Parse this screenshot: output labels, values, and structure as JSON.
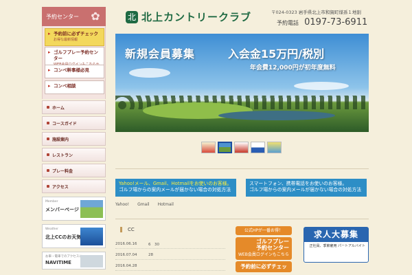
{
  "sidebar": {
    "header": "予約センター",
    "boxes": [
      {
        "title": "予約前に必ずチェック",
        "sub": "お得な最新情報"
      },
      {
        "title": "ゴルフプレー予約センター",
        "sub": "WEB会員ログインもこちらから"
      },
      {
        "title": "コンペ幹事様必見",
        "sub": ""
      },
      {
        "title": "コンペ相談",
        "sub": ""
      }
    ],
    "menu": [
      "ホーム",
      "コースガイド",
      "施設案内",
      "レストラン",
      "プレー料金",
      "アクセス"
    ],
    "banners": [
      {
        "title": "メンバーページ",
        "sub": "Member"
      },
      {
        "title": "北上CCのお天気",
        "sub": "Weather"
      },
      {
        "title": "NAVITIME",
        "sub": "お車・電車でのアクセスに"
      }
    ]
  },
  "header": {
    "logo_mark": "北",
    "logo": "北上カントリークラブ",
    "address": "〒024-0323 岩手県北上市和賀町煤孫１地割",
    "tel_label": "予約電話",
    "tel": "0197-73-6911"
  },
  "hero": {
    "headline": "新規会員募集",
    "fee": "入会金15万円/税別",
    "annual": "年会費12,000円が初年度無料"
  },
  "notices": [
    {
      "line1": "Yahoo!メール、Gmail、Hotmailをお使いのお客様。",
      "line2": "ゴルフ場からの案内メールが届かない場合の対処方法"
    },
    {
      "line1": "スマートフォン、携帯電話をお使いのお客様。",
      "line2": "ゴルフ場からの案内メールが届かない場合の対処方法"
    }
  ],
  "notice_sub": "Yahoo!　　Gmail　　Hotmail",
  "news": {
    "title": "CC",
    "items": [
      {
        "date": "2016.06.16",
        "text": "6　30"
      },
      {
        "date": "2016.07.04",
        "text": "28"
      },
      {
        "date": "2016.04.28",
        "text": ""
      }
    ]
  },
  "right": {
    "hp": "公式HPが一番お得！",
    "golf_big": "ゴルフプレー予約センター",
    "golf_sub": "WEB会員ログインもこちら",
    "check": "予約前に必ずチェック！",
    "job_title": "求人大募集",
    "job_sub": "正社員、季節雇用 パートアルバイト"
  },
  "colors": {
    "green": "#1f6a43",
    "blue": "#2d8ec6",
    "orange": "#e58a29",
    "rose": "#c9706f"
  }
}
